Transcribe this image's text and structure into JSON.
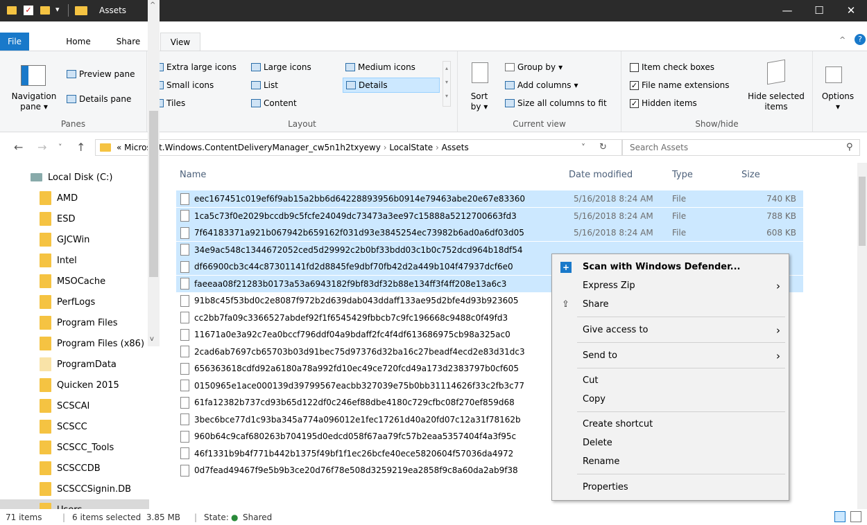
{
  "window": {
    "title": "Assets"
  },
  "ribbon_tabs": [
    "File",
    "Home",
    "Share",
    "View"
  ],
  "panes": {
    "navigation_pane": "Navigation",
    "navigation_pane2": "pane",
    "preview_pane": "Preview pane",
    "details_pane": "Details pane",
    "group_label": "Panes"
  },
  "layout": {
    "extra_large_icons": "Extra large icons",
    "large_icons": "Large icons",
    "medium_icons": "Medium icons",
    "small_icons": "Small icons",
    "list": "List",
    "details": "Details",
    "tiles": "Tiles",
    "content": "Content",
    "group_label": "Layout"
  },
  "current_view": {
    "sort_by": "Sort",
    "sort_by2": "by",
    "group_by": "Group by",
    "add_columns": "Add columns",
    "size_all_columns": "Size all columns to fit",
    "group_label": "Current view"
  },
  "show_hide": {
    "item_check_boxes": "Item check boxes",
    "file_name_extensions": "File name extensions",
    "hidden_items": "Hidden items",
    "hide_selected": "Hide selected",
    "hide_selected2": "items",
    "options": "Options",
    "group_label": "Show/hide",
    "checks": {
      "item_check_boxes": false,
      "file_name_extensions": true,
      "hidden_items": true
    }
  },
  "address": {
    "prefix": "«",
    "crumbs": [
      "Microsoft.Windows.ContentDeliveryManager_cw5n1h2txyewy",
      "LocalState",
      "Assets"
    ],
    "search_placeholder": "Search Assets"
  },
  "nav_items": [
    {
      "label": "Local Disk (C:)",
      "kind": "drive"
    },
    {
      "label": "AMD"
    },
    {
      "label": "ESD"
    },
    {
      "label": "GJCWin"
    },
    {
      "label": "Intel"
    },
    {
      "label": "MSOCache"
    },
    {
      "label": "PerfLogs"
    },
    {
      "label": "Program Files"
    },
    {
      "label": "Program Files (x86)"
    },
    {
      "label": "ProgramData"
    },
    {
      "label": "Quicken 2015"
    },
    {
      "label": "SCSCAI"
    },
    {
      "label": "SCSCC"
    },
    {
      "label": "SCSCC_Tools"
    },
    {
      "label": "SCSCCDB"
    },
    {
      "label": "SCSCCSignin.DB"
    },
    {
      "label": "Users"
    }
  ],
  "columns": {
    "name": "Name",
    "date": "Date modified",
    "type": "Type",
    "size": "Size"
  },
  "files": [
    {
      "name": "eec167451c019ef6f9ab15a2bb6d64228893956b0914e79463abe20e67e83360",
      "date": "5/16/2018 8:24 AM",
      "type": "File",
      "size": "740 KB",
      "selected": true
    },
    {
      "name": "1ca5c73f0e2029bccdb9c5fcfe24049dc73473a3ee97c15888a5212700663fd3",
      "date": "5/16/2018 8:24 AM",
      "type": "File",
      "size": "788 KB",
      "selected": true
    },
    {
      "name": "7f64183371a921b067942b659162f031d93e3845254ec73982b6ad0a6df03d05",
      "date": "5/16/2018 8:24 AM",
      "type": "File",
      "size": "608 KB",
      "selected": true
    },
    {
      "name": "34e9ac548c1344672052ced5d29992c2b0bf33bdd03c1b0c752dcd964b18df54",
      "date": "",
      "type": "",
      "size": "",
      "selected": true
    },
    {
      "name": "df66900cb3c44c87301141fd2d8845fe9dbf70fb42d2a449b104f47937dcf6e0",
      "date": "",
      "type": "",
      "size": "",
      "selected": true
    },
    {
      "name": "faeeaa08f21283b0173a53a6943182f9bf83df32b88e134ff3f4ff208e13a6c3",
      "date": "",
      "type": "",
      "size": "",
      "selected": true
    },
    {
      "name": "91b8c45f53bd0c2e8087f972b2d639dab043ddaff133ae95d2bfe4d93b923605",
      "date": "",
      "type": "",
      "size": "",
      "selected": false
    },
    {
      "name": "cc2bb7fa09c3366527abdef92f1f6545429fbbcb7c9fc196668c9488c0f49fd3",
      "date": "",
      "type": "",
      "size": "",
      "selected": false
    },
    {
      "name": "11671a0e3a92c7ea0bccf796ddf04a9bdaff2fc4f4df613686975cb98a325ac0",
      "date": "",
      "type": "",
      "size": "",
      "selected": false
    },
    {
      "name": "2cad6ab7697cb65703b03d91bec75d97376d32ba16c27beadf4ecd2e83d31dc3",
      "date": "",
      "type": "",
      "size": "",
      "selected": false
    },
    {
      "name": "656363618cdfd92a6180a78a992fd10ec49ce720fcd49a173d2383797b0cf605",
      "date": "",
      "type": "",
      "size": "",
      "selected": false
    },
    {
      "name": "0150965e1ace000139d39799567eacbb327039e75b0bb31114626f33c2fb3c77",
      "date": "",
      "type": "",
      "size": "",
      "selected": false
    },
    {
      "name": "61fa12382b737cd93b65d122df0c246ef88dbe4180c729cfbc08f270ef859d68",
      "date": "",
      "type": "",
      "size": "",
      "selected": false
    },
    {
      "name": "3bec6bce77d1c93ba345a774a096012e1fec17261d40a20fd07c12a31f78162b",
      "date": "",
      "type": "",
      "size": "",
      "selected": false
    },
    {
      "name": "960b64c9caf680263b704195d0edcd058f67aa79fc57b2eaa5357404f4a3f95c",
      "date": "",
      "type": "",
      "size": "",
      "selected": false
    },
    {
      "name": "46f1331b9b4f771b442b1375f49bf1f1ec26bcfe40ece5820604f57036da4972",
      "date": "",
      "type": "",
      "size": "",
      "selected": false
    },
    {
      "name": "0d7fead49467f9e5b9b3ce20d76f78e508d3259219ea2858f9c8a60da2ab9f38",
      "date": "",
      "type": "",
      "size": "",
      "selected": false
    }
  ],
  "context_menu": {
    "scan": "Scan with Windows Defender...",
    "express_zip": "Express Zip",
    "share": "Share",
    "give_access": "Give access to",
    "send_to": "Send to",
    "cut": "Cut",
    "copy": "Copy",
    "create_shortcut": "Create shortcut",
    "delete": "Delete",
    "rename": "Rename",
    "properties": "Properties"
  },
  "status": {
    "items": "71 items",
    "selected": "6 items selected  3.85 MB",
    "state_label": "State:",
    "state_value": "Shared"
  },
  "colors": {
    "accent": "#1979ca",
    "selection": "#cce8ff",
    "titlebar": "#2b2b2b",
    "folder": "#f5c342"
  }
}
